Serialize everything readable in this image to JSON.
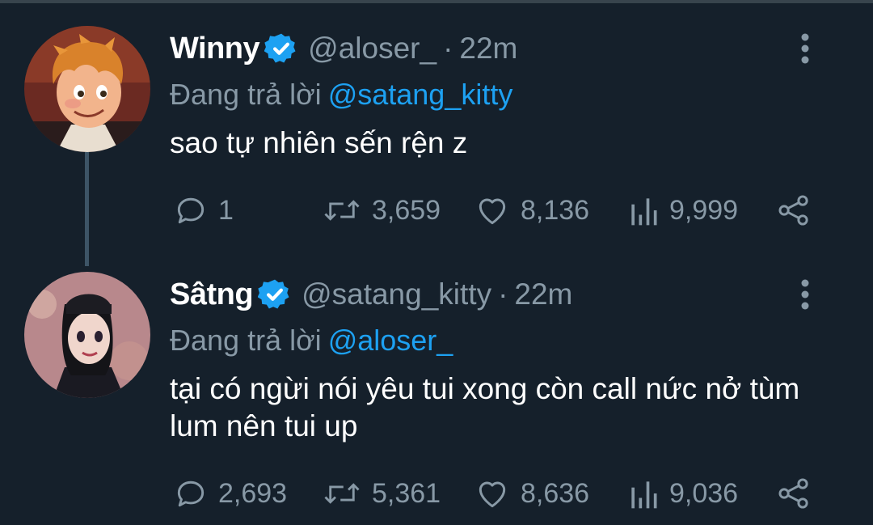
{
  "tweets": [
    {
      "name": "Winny",
      "handle": "@aloser_",
      "separator": "·",
      "time": "22m",
      "reply_prefix": "Đang trả lời",
      "reply_to": "@satang_kitty",
      "text": "sao tự nhiên sến rện z",
      "replies": "1",
      "retweets": "3,659",
      "likes": "8,136",
      "views": "9,999",
      "avatar_icon": "avatar-boy-cartoon"
    },
    {
      "name": "Sâtng",
      "handle": "@satang_kitty",
      "separator": "·",
      "time": "22m",
      "reply_prefix": "Đang trả lời",
      "reply_to": "@aloser_",
      "text": "tại có ngừi nói yêu tui xong còn call nức nở tùm lum nên tui up",
      "replies": "2,693",
      "retweets": "5,361",
      "likes": "8,636",
      "views": "9,036",
      "avatar_icon": "avatar-girl-cartoon"
    }
  ],
  "colors": {
    "background": "#15202b",
    "muted": "#8899a6",
    "accent": "#1da1f2",
    "thread_line": "#3d5466"
  }
}
